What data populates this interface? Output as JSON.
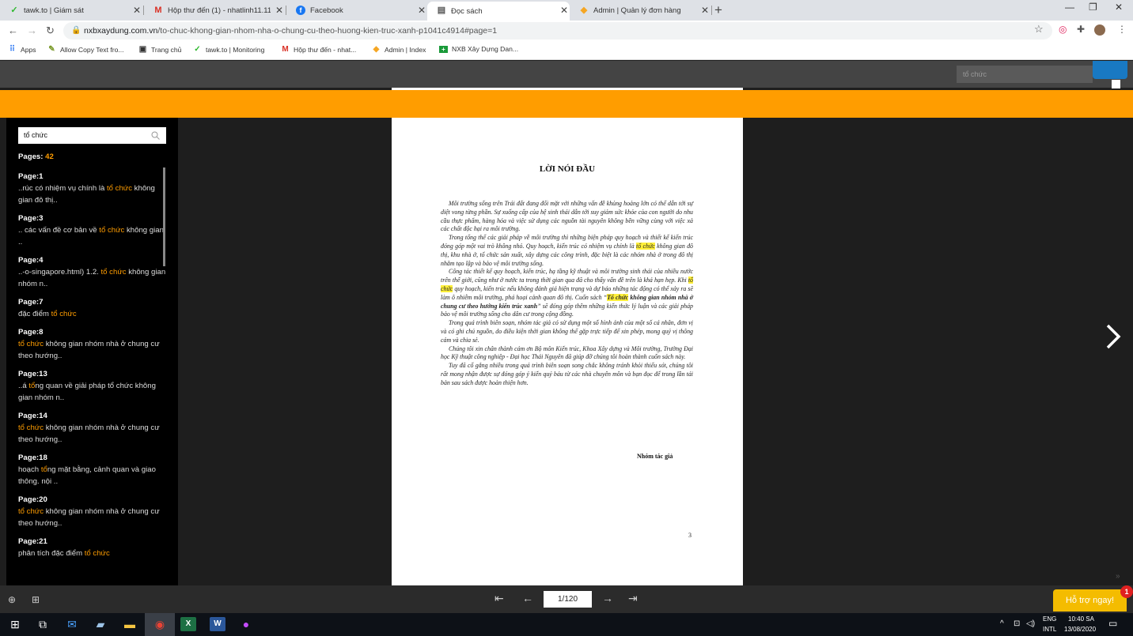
{
  "tabs": [
    {
      "title": "tawk.to | Giám sát",
      "icon": "tawk-icon"
    },
    {
      "title": "Hộp thư đến (1) - nhatlinh11.11",
      "icon": "gmail-icon"
    },
    {
      "title": "Facebook",
      "icon": "facebook-icon"
    },
    {
      "title": "Đọc sách",
      "icon": "reader-icon"
    },
    {
      "title": "Admin | Quản lý đơn hàng",
      "icon": "admin-icon"
    }
  ],
  "address": {
    "host": "nxbxaydung.com.vn",
    "path": "/to-chuc-khong-gian-nhom-nha-o-chung-cu-theo-huong-kien-truc-xanh-p1041c4914#page=1"
  },
  "bookmarks": [
    {
      "label": "Apps"
    },
    {
      "label": "Allow Copy Text fro..."
    },
    {
      "label": "Trang chủ"
    },
    {
      "label": "tawk.to | Monitoring"
    },
    {
      "label": "Hộp thư đến - nhat..."
    },
    {
      "label": "Admin | Index"
    },
    {
      "label": "NXB Xây Dựng Dan..."
    }
  ],
  "top_search": {
    "value": "tổ chức"
  },
  "sidebar": {
    "search_value": "tổ chức",
    "pages_label": "Pages:",
    "pages_count": "42",
    "results": [
      {
        "page": "Page:1",
        "pre": "..rúc có nhiệm vụ chính là ",
        "hit": "tổ chức",
        "post": " không gian đô thị.."
      },
      {
        "page": "Page:3",
        "pre": ".. các vấn đề cơ bản về ",
        "hit": "tổ chức",
        "post": " không gian .."
      },
      {
        "page": "Page:4",
        "pre": "..-o-singapore.html) 1.2. ",
        "hit": "tổ chức",
        "post": " không gian nhóm n.."
      },
      {
        "page": "Page:7",
        "pre": "đặc điểm ",
        "hit": "tổ chức",
        "post": ""
      },
      {
        "page": "Page:8",
        "pre": "",
        "hit": "tổ chức",
        "post": " không gian nhóm nhà ở chung cư theo hướng.."
      },
      {
        "page": "Page:13",
        "pre": "..á ",
        "hit": "tổ",
        "post": "ng quan về giải pháp tổ chức không gian nhóm n.."
      },
      {
        "page": "Page:14",
        "pre": "",
        "hit": "tổ chức",
        "post": " không gian nhóm nhà ở chung cư theo hướng.."
      },
      {
        "page": "Page:18",
        "pre": "hoạch ",
        "hit": "tổ",
        "post": "ng mặt bằng, cảnh quan và giao thông. nội .."
      },
      {
        "page": "Page:20",
        "pre": "",
        "hit": "tổ chức",
        "post": " không gian nhóm nhà ở chung cư theo hướng.."
      },
      {
        "page": "Page:21",
        "pre": "phân tích đặc điểm ",
        "hit": "tổ chức",
        "post": ""
      }
    ]
  },
  "document": {
    "title": "LỜI NÓI ĐẦU",
    "p1": "Môi trường sống trên Trái đất đang đối mặt với những vấn đề khủng hoảng lớn có thể dẫn tới sự diệt vong từng phần. Sự xuống cấp của hệ sinh thái dẫn tới suy giảm sức khỏe của con người do nhu cầu thực phẩm, hàng hóa và việc sử dụng các nguồn tài nguyên không bền vững cùng với việc xả các chất độc hại ra môi trường.",
    "p2a": "Trong tổng thể các giải pháp về môi trường thì những biện pháp quy hoạch và thiết kế kiến trúc đóng góp một vai trò không nhỏ. Quy hoạch, kiến trúc có nhiệm vụ chính là ",
    "p2hl": "tổ chức",
    "p2b": " không gian đô thị, khu nhà ở, tổ chức sản xuất, xây dựng các công trình, đặc biệt là các nhóm nhà ở trong đô thị nhằm tạo lập và bảo vệ môi trường sống.",
    "p3a": "Công tác thiết kế quy hoạch, kiến trúc, hạ tầng kỹ thuật và môi trường sinh thái của nhiều nước trên thế giới, cũng như ở nước ta trong thời gian qua đã cho thấy vấn đề trên là khá hạn hẹp. Khi ",
    "p3hl": "tổ chức",
    "p3b": " quy hoạch, kiến trúc nếu không đánh giá hiện trạng và dự báo những tác động có thể xảy ra sẽ làm ô nhiễm môi trường, phá hoại cảnh quan đô thị. Cuốn sách “",
    "p3hl2": "Tổ chức",
    "p3bold": " không gian nhóm nhà ở chung cư theo hướng kiến trúc xanh",
    "p3c": "” sẽ đóng góp thêm những kiến thức lý luận và các giải pháp bảo vệ môi trường sống cho dân cư trong cộng đồng.",
    "p4": "Trong quá trình biên soạn, nhóm tác giả có sử dụng một số hình ảnh của một số cá nhân, đơn vị và có ghi chú nguồn, do điều kiện thời gian không thể gặp trực tiếp để xin phép, mong quý vị thông cảm và chia sẻ.",
    "p5": "Chúng tôi xin chân thành cảm ơn Bộ môn Kiến trúc, Khoa Xây dựng và Môi trường, Trường Đại học Kỹ thuật công nghiệp - Đại học Thái Nguyên đã giúp đỡ chúng tôi hoàn thành cuốn sách này.",
    "p6": "Tuy đã cố gắng nhiều trong quá trình biên soạn song chắc không tránh khỏi thiếu sót, chúng tôi rất mong nhận được sự đóng góp ý kiến quý báu từ các nhà chuyên môn và bạn đọc để trong lần tái bản sau sách được hoàn thiện hơn.",
    "signature": "Nhóm tác giả",
    "page_number": "3"
  },
  "pager": {
    "value": "1/120"
  },
  "support": {
    "label": "Hỗ trợ ngay!",
    "badge": "1"
  },
  "taskbar": {
    "lang": "ENG",
    "layout": "INTL",
    "time": "10:40 SA",
    "date": "13/08/2020"
  },
  "colors": {
    "accent": "#ff9d00",
    "blue": "#1979c3",
    "support": "#f4bc00"
  }
}
